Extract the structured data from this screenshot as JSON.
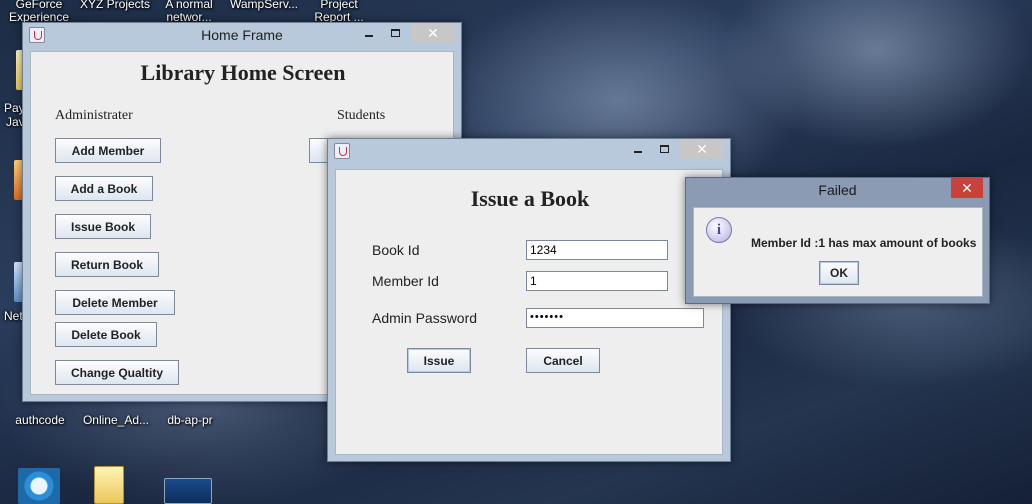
{
  "desktop": {
    "top_icons": [
      "GeForce\nExperience",
      "XYZ Projects",
      "A normal\nnetwor...",
      "WampServ...",
      "Project\nReport ..."
    ],
    "left_labels": [
      "Pay",
      "Java",
      "Net"
    ],
    "bottom_icons": [
      "authcode",
      "Online_Ad...",
      "db-ap-pr"
    ]
  },
  "home_frame": {
    "title": "Home Frame",
    "heading": "Library Home Screen",
    "admin_label": "Administrater",
    "students_label": "Students",
    "buttons": [
      "Add Member",
      "Add a Book",
      "Issue Book",
      "Return Book",
      "Delete Member",
      "Delete Book",
      "Change Qualtity"
    ]
  },
  "issue_window": {
    "title": "",
    "heading": "Issue a Book",
    "book_id_label": "Book Id",
    "book_id_value": "1234",
    "member_id_label": "Member Id",
    "member_id_value": "1",
    "password_label": "Admin Password",
    "password_value": "•••••••",
    "issue_label": "Issue",
    "cancel_label": "Cancel"
  },
  "failed_dialog": {
    "title": "Failed",
    "message": "Member Id :1 has max amount of books",
    "ok_label": "OK"
  },
  "colors": {
    "window_frame": "#b9c9dc",
    "client_bg": "#eeeeee",
    "close_red": "#c8413a"
  }
}
